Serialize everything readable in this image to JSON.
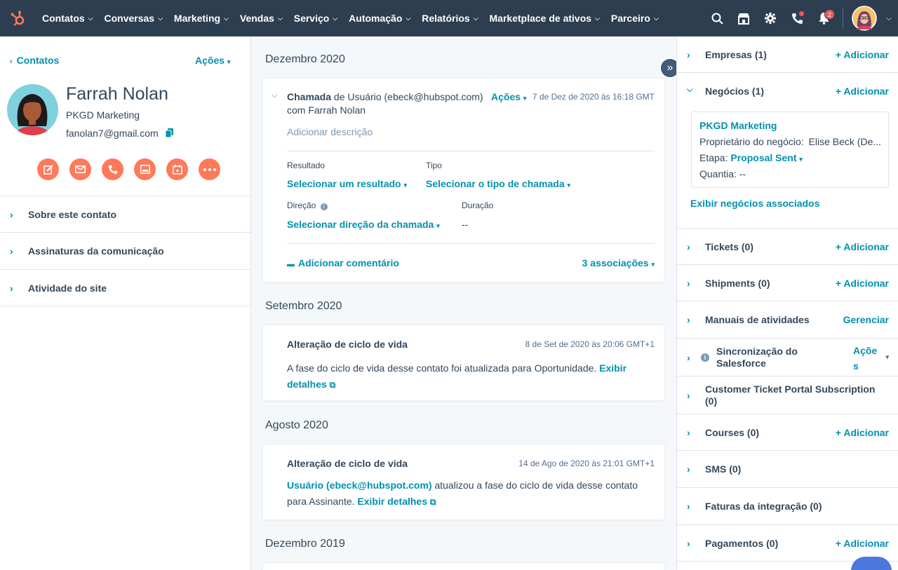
{
  "nav": {
    "items": [
      "Contatos",
      "Conversas",
      "Marketing",
      "Vendas",
      "Serviço",
      "Automação",
      "Relatórios",
      "Marketplace de ativos",
      "Parceiro"
    ],
    "notification_count": "2"
  },
  "contact": {
    "back_label": "Contatos",
    "actions_label": "Ações",
    "name": "Farrah Nolan",
    "company": "PKGD Marketing",
    "email": "fanolan7@gmail.com",
    "action_icons": [
      "note-icon",
      "email-icon",
      "call-icon",
      "task-icon",
      "meeting-icon",
      "more-icon"
    ],
    "sections": [
      "Sobre este contato",
      "Assinaturas da comunicação",
      "Atividade do site"
    ]
  },
  "timeline": {
    "months": [
      "Dezembro 2020",
      "Setembro 2020",
      "Agosto 2020",
      "Dezembro 2019"
    ],
    "call": {
      "type": "Chamada",
      "by": "de Usuário (ebeck@hubspot.com)",
      "with": "com Farrah Nolan",
      "actions": "Ações",
      "date": "7 de Dez de 2020 às 16:18 GMT",
      "desc_placeholder": "Adicionar descrição",
      "result_label": "Resultado",
      "result_value": "Selecionar um resultado",
      "type_label": "Tipo",
      "type_value": "Selecionar o tipo de chamada",
      "direction_label": "Direção",
      "direction_value": "Selecionar direção da chamada",
      "duration_label": "Duração",
      "duration_value": "--",
      "comment": "Adicionar comentário",
      "associations": "3 associações"
    },
    "lifecycle1": {
      "title": "Alteração de ciclo de vida",
      "date": "8 de Set de 2020 às 20:06 GMT+1",
      "text": "A fase do ciclo de vida desse contato foi atualizada para Oportunidade.",
      "link1": "Exibir",
      "link2": "detalhes"
    },
    "lifecycle2": {
      "title": "Alteração de ciclo de vida",
      "date": "14 de Ago de 2020 às 21:01 GMT+1",
      "user": "Usuário (ebeck@hubspot.com)",
      "text1": "atualizou a fase do ciclo de vida desse contato",
      "text2": "para Assinante.",
      "link": "Exibir detalhes"
    }
  },
  "sidebar": {
    "add_label": "+ Adicionar",
    "companies": "Empresas (1)",
    "deals": "Negócios (1)",
    "deal": {
      "name": "PKGD Marketing",
      "owner_label": "Proprietário do negócio:",
      "owner_value": "Elise Beck (De...",
      "stage_label": "Etapa:",
      "stage_value": "Proposal Sent",
      "amount_label": "Quantia:",
      "amount_value": "--"
    },
    "view_deals": "Exibir negócios associados",
    "tickets": "Tickets (0)",
    "shipments": "Shipments (0)",
    "playbooks": "Manuais de atividades",
    "manage": "Gerenciar",
    "salesforce_1": "Sincronização do",
    "salesforce_2": "Salesforce",
    "sf_actions_1": "Açõe",
    "sf_actions_2": "s",
    "ticket_portal_1": "Customer Ticket Portal Subscription",
    "ticket_portal_2": "(0)",
    "courses": "Courses (0)",
    "sms": "SMS (0)",
    "invoices": "Faturas da integração (0)",
    "payments": "Pagamentos (0)"
  }
}
